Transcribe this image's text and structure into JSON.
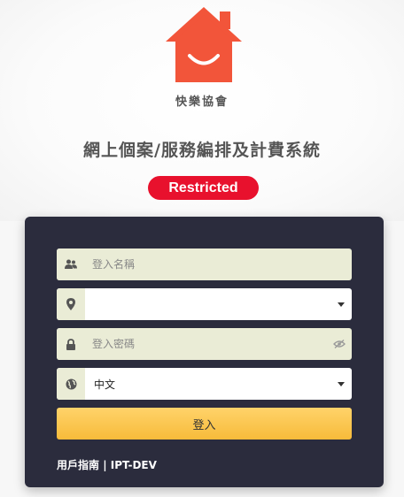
{
  "brand": {
    "logo_text": "快樂協會"
  },
  "header": {
    "system_title": "網上個案/服務編排及計費系統",
    "badge": "Restricted"
  },
  "login": {
    "username_placeholder": "登入名稱",
    "location_value": "",
    "password_placeholder": "登入密碼",
    "language_value": "中文",
    "login_button": "登入"
  },
  "footer": {
    "guide_link": "用戶指南",
    "separator": "|",
    "env_label": "IPT-DEV"
  },
  "colors": {
    "logo_orange": "#f2553a",
    "badge_red": "#e8112d",
    "panel_dark": "#2b2c3d",
    "input_beige": "#eaecd6",
    "button_yellow": "#f7bb3a"
  },
  "icons": {
    "username": "users-icon",
    "location": "map-marker-icon",
    "password": "lock-icon",
    "password_toggle": "eye-slash-icon",
    "language": "globe-icon",
    "dropdown": "caret-down-icon"
  }
}
